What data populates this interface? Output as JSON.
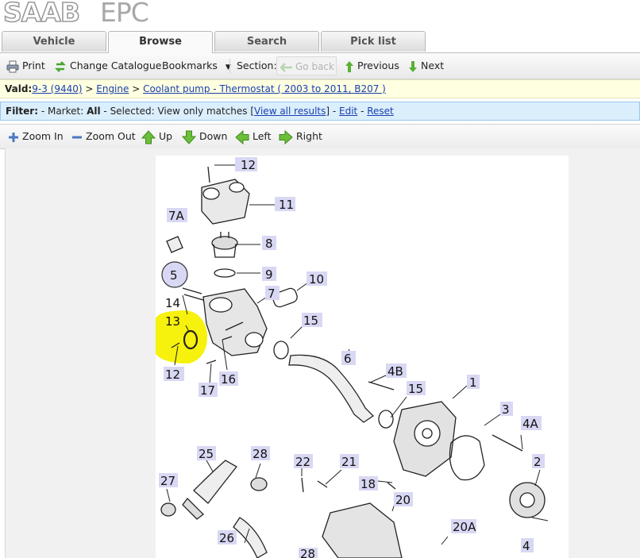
{
  "logo": {
    "brand": "SAAB",
    "product": "EPC"
  },
  "tabs": [
    {
      "label": "Vehicle"
    },
    {
      "label": "Browse",
      "active": true
    },
    {
      "label": "Search"
    },
    {
      "label": "Pick list"
    }
  ],
  "toolbar": {
    "print": "Print",
    "change_catalogue": "Change Catalogue",
    "bookmarks": "Bookmarks",
    "section": "Section:",
    "go_back": "Go back",
    "previous": "Previous",
    "next": "Next"
  },
  "valid": {
    "label": "Vald:",
    "model": "9-3 (9440)",
    "sep1": " > ",
    "group": "Engine",
    "sep2": " > ",
    "section": "Coolant pump - Thermostat ( 2003 to 2011, B207 )"
  },
  "filter": {
    "label": "Filter:",
    "market_text": " - Market: ",
    "market_value": "All",
    "selected_text": " - Selected: ",
    "selected_value": "View only matches [",
    "view_all": "View all results",
    "close_bracket": "] - ",
    "edit": "Edit",
    "dash": " - ",
    "reset": "Reset"
  },
  "zoombar": {
    "zoom_in": "Zoom In",
    "zoom_out": "Zoom Out",
    "up": "Up",
    "down": "Down",
    "left": "Left",
    "right": "Right"
  },
  "diagram": {
    "callouts": [
      "12",
      "11",
      "7A",
      "8",
      "5",
      "9",
      "10",
      "7",
      "14",
      "13",
      "15",
      "12",
      "16",
      "17",
      "6",
      "4B",
      "15",
      "1",
      "3",
      "4A",
      "25",
      "28",
      "22",
      "21",
      "2",
      "27",
      "18",
      "20",
      "26",
      "20A",
      "4",
      "27",
      "28",
      "20"
    ],
    "highlight_color": "#f5f000",
    "label_bg": "#d8d8f4"
  },
  "colors": {
    "link": "#1a3fb0",
    "valid_bg": "#ffffe1",
    "filter_bg": "#dbeefc",
    "arrow_green": "#58b135"
  }
}
